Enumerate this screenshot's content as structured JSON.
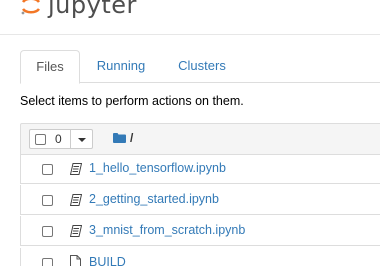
{
  "header": {
    "logo_text": "jupyter",
    "logo_icon": "jupyter-logo-icon",
    "accent_color": "#f37726"
  },
  "tabs": [
    {
      "label": "Files",
      "active": true
    },
    {
      "label": "Running",
      "active": false
    },
    {
      "label": "Clusters",
      "active": false
    }
  ],
  "instructions": "Select items to perform actions on them.",
  "toolbar": {
    "selected_count": "0",
    "breadcrumb_icon": "folder-icon",
    "breadcrumb": "/"
  },
  "files": [
    {
      "name": "1_hello_tensorflow.ipynb",
      "icon": "notebook-icon"
    },
    {
      "name": "2_getting_started.ipynb",
      "icon": "notebook-icon"
    },
    {
      "name": "3_mnist_from_scratch.ipynb",
      "icon": "notebook-icon"
    },
    {
      "name": "BUILD",
      "icon": "file-icon"
    }
  ],
  "colors": {
    "link": "#337ab7",
    "border": "#dddddd",
    "toolbar_bg": "#f5f5f5"
  }
}
